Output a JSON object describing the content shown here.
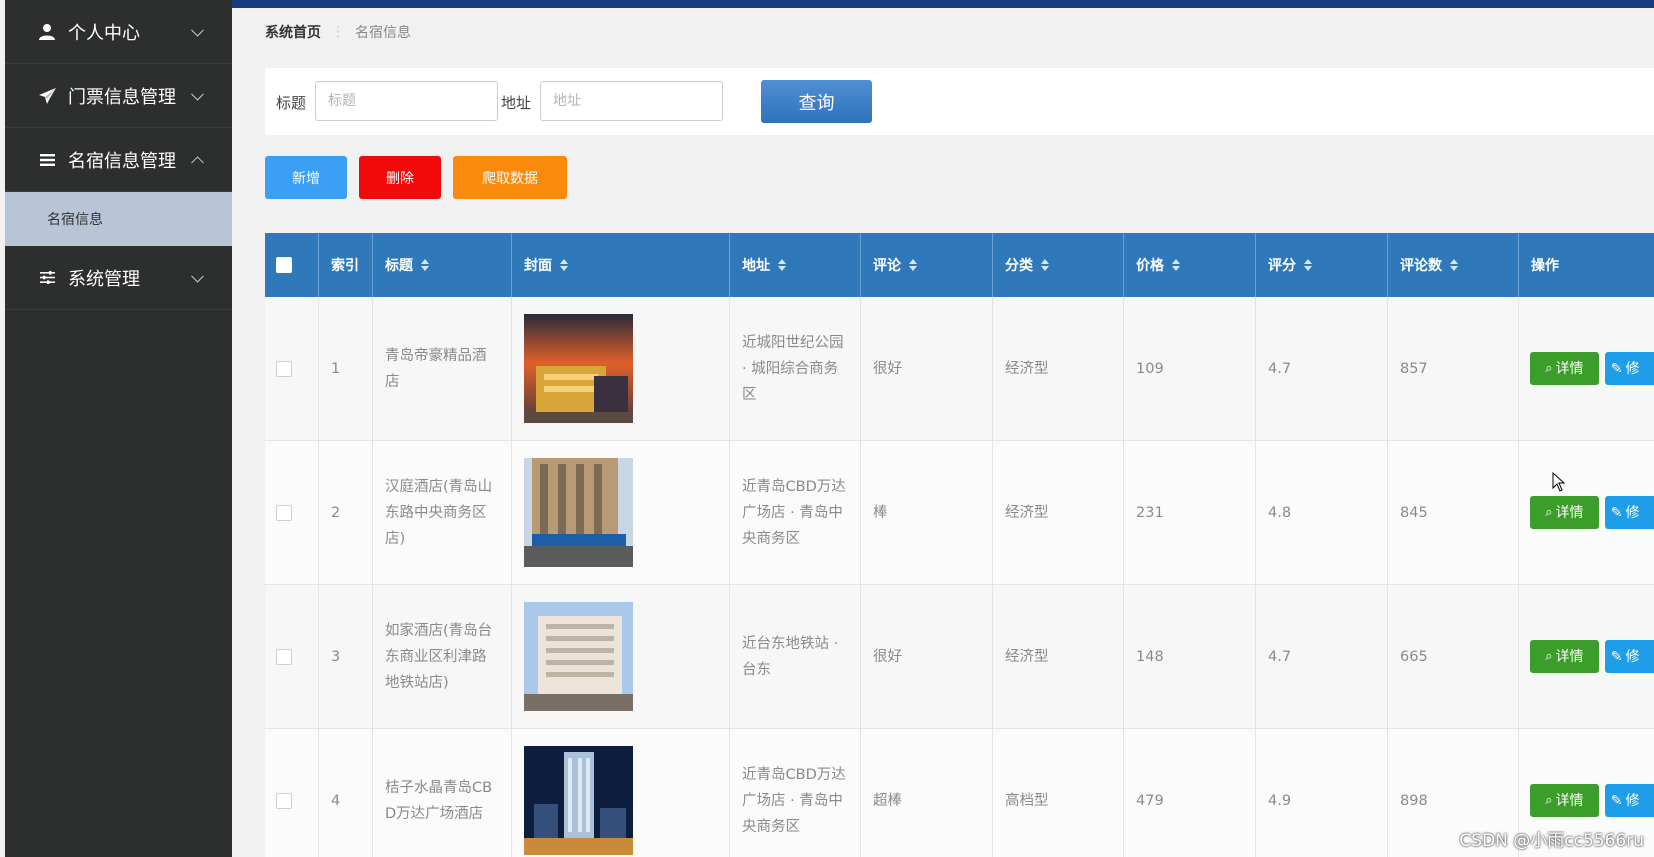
{
  "sidebar": {
    "items": [
      {
        "label": "个人中心",
        "icon": "user-icon"
      },
      {
        "label": "门票信息管理",
        "icon": "paper-plane-icon"
      },
      {
        "label": "名宿信息管理",
        "icon": "list-icon",
        "expanded": true,
        "children": [
          {
            "label": "名宿信息"
          }
        ]
      },
      {
        "label": "系统管理",
        "icon": "sliders-icon"
      }
    ]
  },
  "breadcrumb": {
    "home": "系统首页",
    "current": "名宿信息"
  },
  "search": {
    "title_label": "标题",
    "title_placeholder": "标题",
    "address_label": "地址",
    "address_placeholder": "地址",
    "query_label": "查询"
  },
  "actions": {
    "add": "新增",
    "delete": "删除",
    "crawl": "爬取数据"
  },
  "colors": {
    "sidebar_bg": "#2d2e2e",
    "table_header": "#2f79bb",
    "add": "#3a9ff5",
    "delete": "#f20a0a",
    "crawl": "#fa8a0c",
    "detail": "#3b9e2b",
    "edit": "#1e9de8"
  },
  "table": {
    "headers": {
      "index": "索引",
      "title": "标题",
      "cover": "封面",
      "address": "地址",
      "comment": "评论",
      "category": "分类",
      "price": "价格",
      "rating": "评分",
      "review_count": "评论数",
      "ops": "操作"
    },
    "rows": [
      {
        "index": "1",
        "title": [
          "青岛帝豪精品酒",
          "店"
        ],
        "address": [
          "近城阳世纪公园",
          "· 城阳综合商务",
          "区"
        ],
        "comment": "很好",
        "category": "经济型",
        "price": "109",
        "rating": "4.7",
        "review_count": "857",
        "detail": "详情",
        "edit": "修"
      },
      {
        "index": "2",
        "title": [
          "汉庭酒店(青岛山",
          "东路中央商务区",
          "店)"
        ],
        "address": [
          "近青岛CBD万达",
          "广场店 · 青岛中",
          "央商务区"
        ],
        "comment": "棒",
        "category": "经济型",
        "price": "231",
        "rating": "4.8",
        "review_count": "845",
        "detail": "详情",
        "edit": "修"
      },
      {
        "index": "3",
        "title": [
          "如家酒店(青岛台",
          "东商业区利津路",
          "地铁站店)"
        ],
        "address": [
          "近台东地铁站 ·",
          "台东"
        ],
        "comment": "很好",
        "category": "经济型",
        "price": "148",
        "rating": "4.7",
        "review_count": "665",
        "detail": "详情",
        "edit": "修"
      },
      {
        "index": "4",
        "title": [
          "桔子水晶青岛CB",
          "D万达广场酒店"
        ],
        "address": [
          "近青岛CBD万达",
          "广场店 · 青岛中",
          "央商务区"
        ],
        "comment": "超棒",
        "category": "高档型",
        "price": "479",
        "rating": "4.9",
        "review_count": "898",
        "detail": "详情",
        "edit": "修"
      }
    ]
  },
  "watermark": "CSDN @小雨cc5566ru"
}
